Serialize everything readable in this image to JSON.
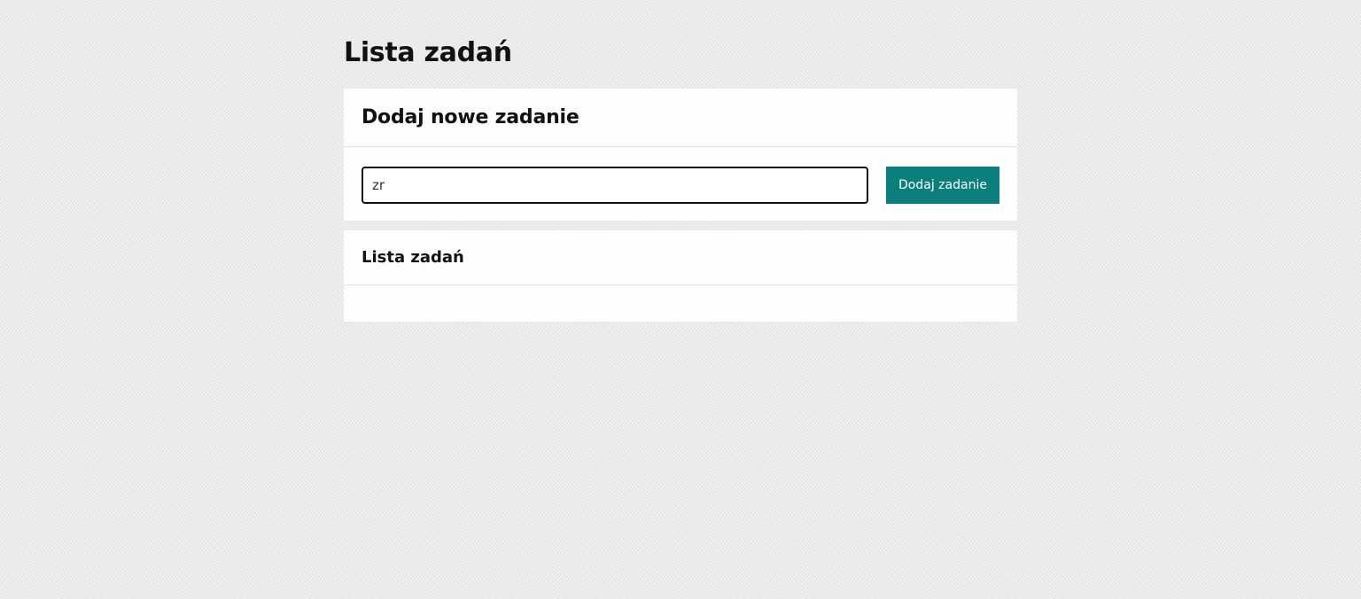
{
  "page": {
    "title": "Lista zadań"
  },
  "add_task": {
    "title": "Dodaj nowe zadanie",
    "input_value": "zr",
    "button_label": "Dodaj zadanie"
  },
  "task_list": {
    "title": "Lista zadań",
    "items": []
  },
  "colors": {
    "accent": "#0b7f7b",
    "background": "#ebebeb",
    "card": "#fdfdfd"
  }
}
